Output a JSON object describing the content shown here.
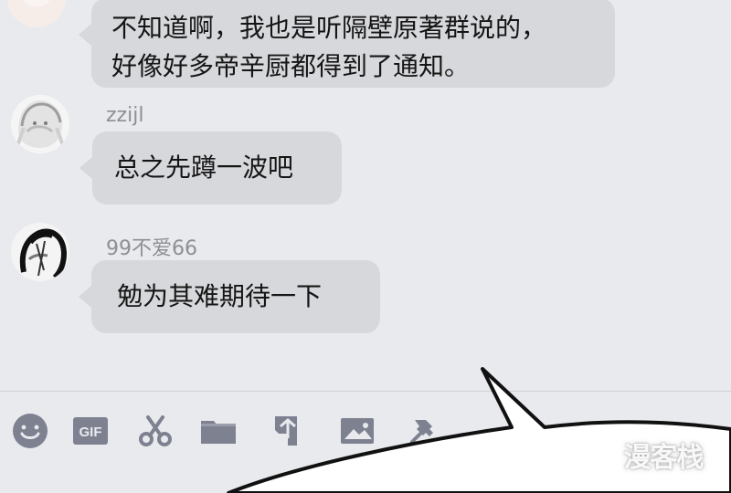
{
  "messages": [
    {
      "text_lines": [
        "不知道啊，我也是听隔壁原著群说的，",
        "好像好多帝辛厨都得到了通知。"
      ]
    },
    {
      "username": "zzijl",
      "text": "总之先蹲一波吧"
    },
    {
      "username": "99不爱66",
      "text": "勉为其难期待一下"
    }
  ],
  "toolbar": {
    "gif_label": "GIF",
    "tools": [
      "emoji-icon",
      "gif-icon",
      "scissors-icon",
      "folder-icon",
      "share-icon",
      "image-icon",
      "pin-icon"
    ]
  },
  "watermark": {
    "text": "漫客栈"
  },
  "colors": {
    "background": "#e9eaee",
    "bubble": "#d7d8dc",
    "username": "#8d8f94",
    "icon": "#7d8190",
    "overlay": "#ffffff"
  }
}
